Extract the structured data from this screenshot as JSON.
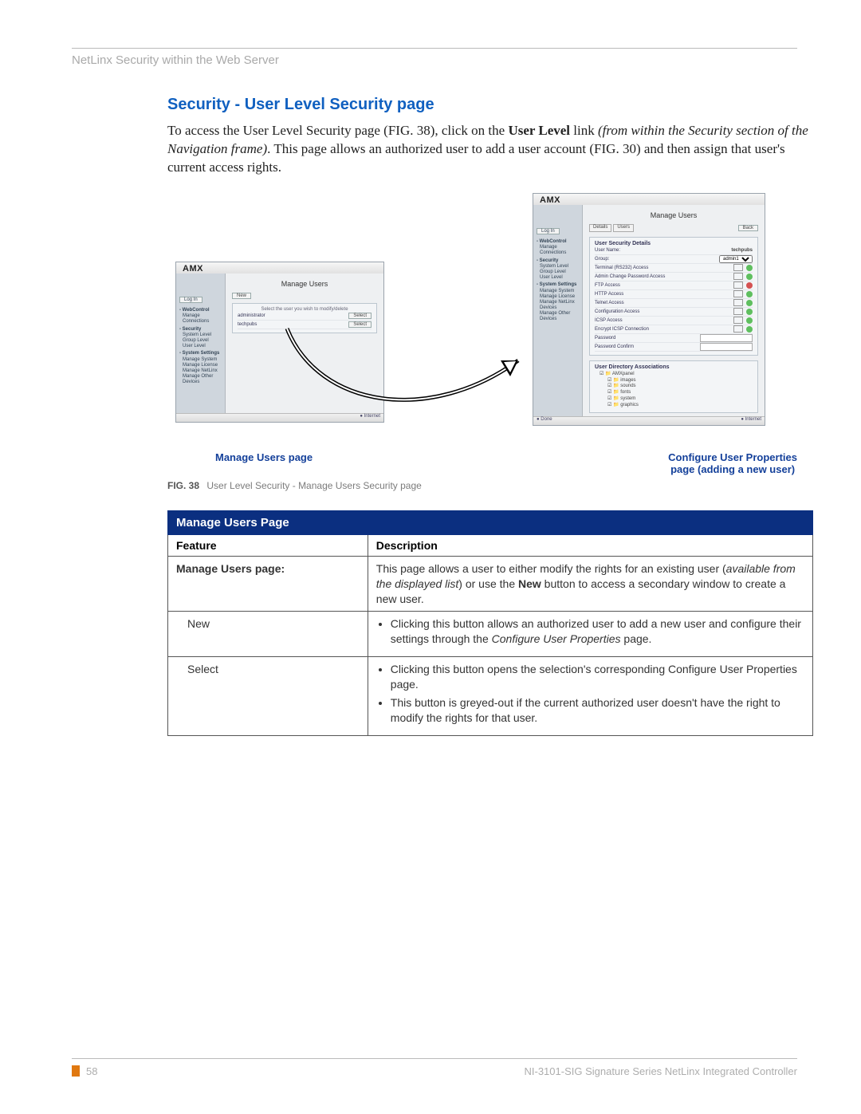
{
  "running_head": "NetLinx Security within the Web Server",
  "section_title": "Security - User Level Security page",
  "para": {
    "p1a": "To access the User Level Security page (FIG. 38), click on the ",
    "p1b_bold": "User Level",
    "p1c": " link ",
    "p1d_ital": "(from within the Security section of the Navigation frame)",
    "p1e": ". This page allows an authorized user to add a user account (FIG. 30) and then assign that user's current access rights."
  },
  "screenshot": {
    "brand": "AMX",
    "title": "Manage Users",
    "tabs": [
      "Details",
      "Users"
    ],
    "btn_new": "New",
    "btn_back": "Back",
    "btn_select": "Select",
    "btn_login": "Log In",
    "instruction": "Select the user you wish to modify/delete",
    "list_users": [
      "administrator",
      "techpubs"
    ],
    "sidebar_items": [
      "WebControl",
      "Manage Connections",
      "Security",
      "System Level",
      "Group Level",
      "User Level",
      "System Settings",
      "Manage System",
      "Manage License",
      "Manage NetLinx Devices",
      "Manage Other Devices"
    ],
    "detail_head": "User Security Details",
    "detail_user": "techpubs",
    "field_user": "User Name:",
    "field_group": "Group:",
    "group_value": "admin1",
    "rows": [
      {
        "label": "Terminal (RS232) Access",
        "green": true
      },
      {
        "label": "Admin Change Password Access",
        "green": true
      },
      {
        "label": "FTP Access",
        "green": false
      },
      {
        "label": "HTTP Access",
        "green": true
      },
      {
        "label": "Telnet Access",
        "green": true
      },
      {
        "label": "Configuration Access",
        "green": true
      },
      {
        "label": "ICSP Access",
        "green": true
      },
      {
        "label": "Encrypt ICSP Connection",
        "green": true
      }
    ],
    "field_pw": "Password",
    "field_pwc": "Password Confirm",
    "assoc_head": "User Directory Associations",
    "tree": [
      "AMXpanel",
      "images",
      "sounds",
      "fonts",
      "system",
      "graphics"
    ],
    "status_done": "Done",
    "status_net": "Internet"
  },
  "labels": {
    "left": "Manage Users page",
    "right1": "Configure User Properties",
    "right2": "page (adding a new user)"
  },
  "figure": {
    "no": "FIG. 38",
    "caption": "User Level Security - Manage Users Security page"
  },
  "table": {
    "title": "Manage Users Page",
    "col1": "Feature",
    "col2": "Description",
    "row1_f": "Manage Users page:",
    "row1_d_a": "This page allows a user to either modify the rights for an existing user (",
    "row1_d_b_ital": "available from the displayed list",
    "row1_d_c": ") or use the ",
    "row1_d_d_bold": "New",
    "row1_d_e": " button to access a secondary window to create a new user.",
    "row2_f": "New",
    "row2_b1a": "Clicking this button allows an authorized user to add a new user and configure their settings through the ",
    "row2_b1b_ital": "Configure User Properties",
    "row2_b1c": " page.",
    "row3_f": "Select",
    "row3_b1": "Clicking this button opens the selection's corresponding Configure User Properties page.",
    "row3_b2": "This button is greyed-out if the current authorized user doesn't have the right to modify the rights for that user."
  },
  "footer": {
    "page": "58",
    "doc": "NI-3101-SIG Signature Series NetLinx Integrated Controller"
  }
}
